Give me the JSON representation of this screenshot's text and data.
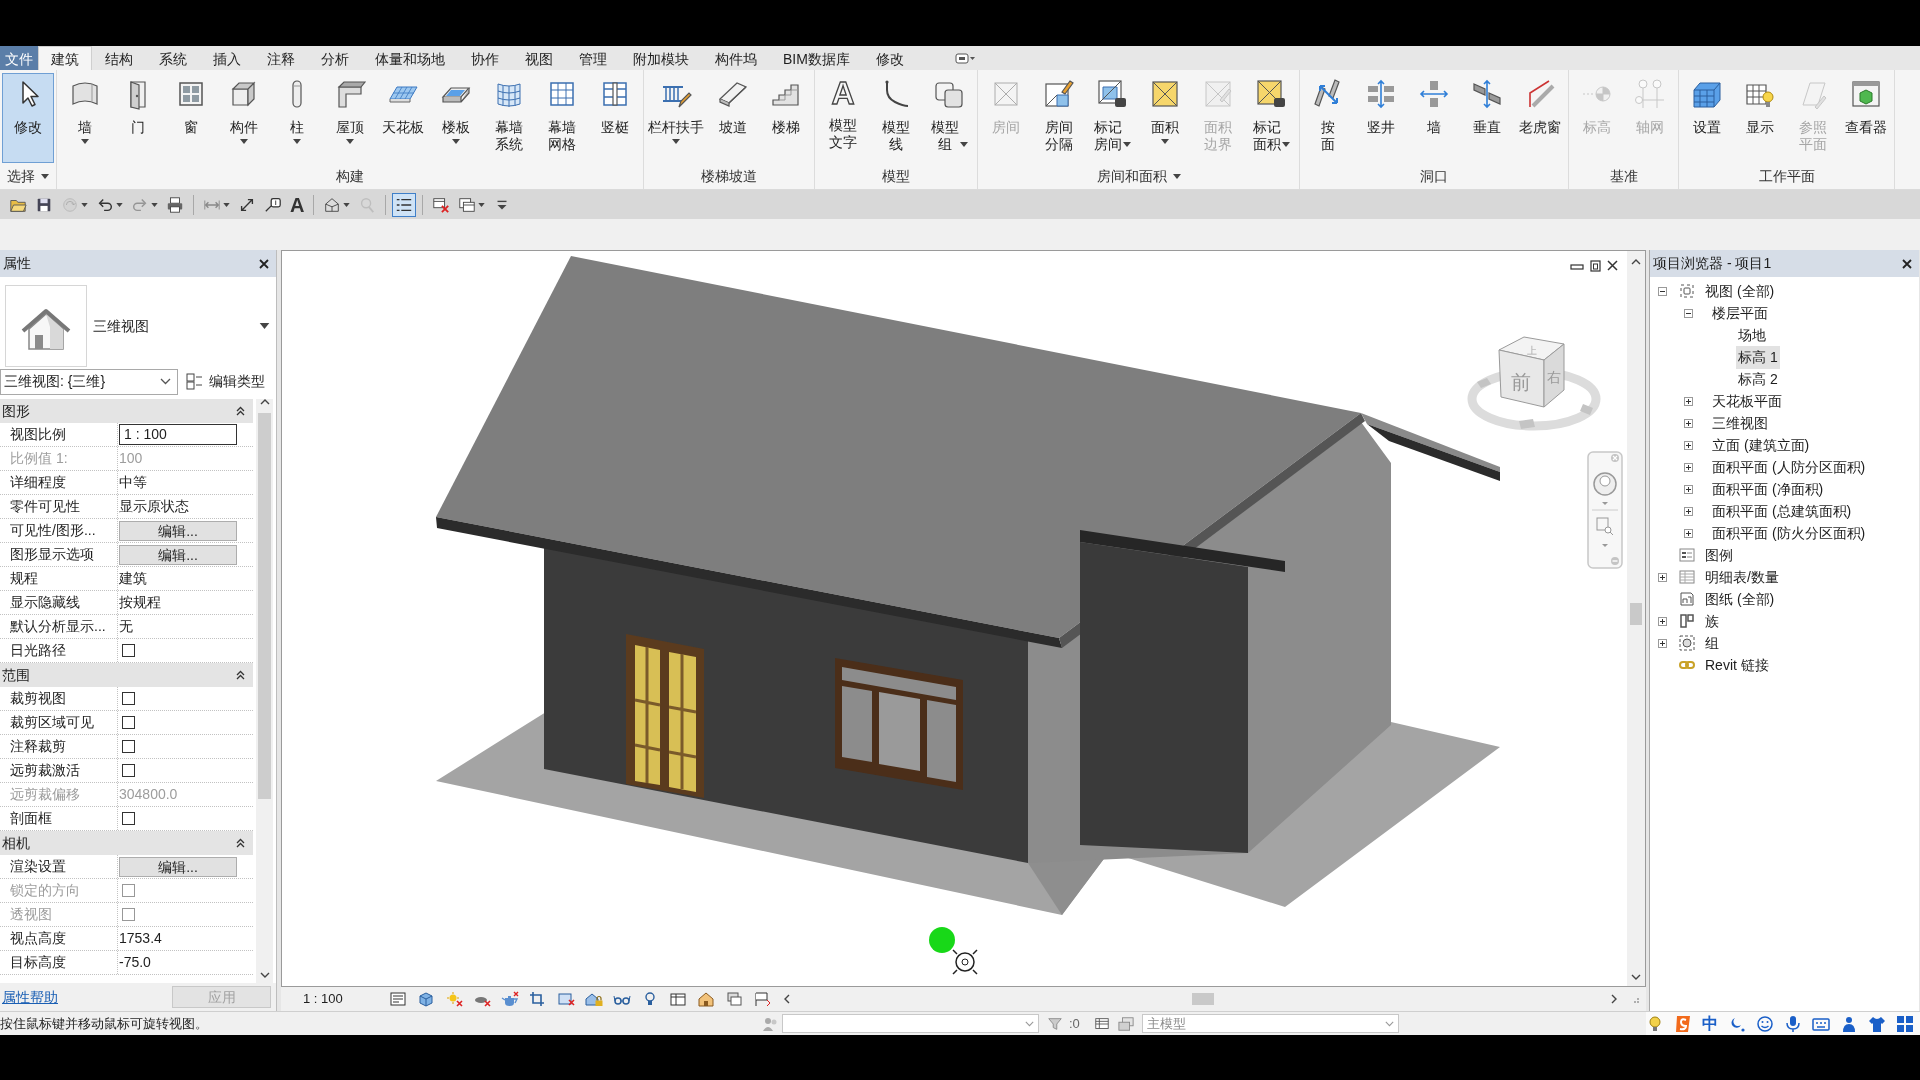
{
  "ribbon": {
    "tabs": [
      {
        "label": "文件",
        "kind": "file",
        "selected": false
      },
      {
        "label": "建筑",
        "kind": "tab",
        "selected": true
      },
      {
        "label": "结构",
        "kind": "tab",
        "selected": false
      },
      {
        "label": "系统",
        "kind": "tab",
        "selected": false
      },
      {
        "label": "插入",
        "kind": "tab",
        "selected": false
      },
      {
        "label": "注释",
        "kind": "tab",
        "selected": false
      },
      {
        "label": "分析",
        "kind": "tab",
        "selected": false
      },
      {
        "label": "体量和场地",
        "kind": "tab",
        "selected": false
      },
      {
        "label": "协作",
        "kind": "tab",
        "selected": false
      },
      {
        "label": "视图",
        "kind": "tab",
        "selected": false
      },
      {
        "label": "管理",
        "kind": "tab",
        "selected": false
      },
      {
        "label": "附加模块",
        "kind": "tab",
        "selected": false
      },
      {
        "label": "构件坞",
        "kind": "tab",
        "selected": false
      },
      {
        "label": "BIM数据库",
        "kind": "tab",
        "selected": false
      },
      {
        "label": "修改",
        "kind": "tab",
        "selected": false
      }
    ],
    "panels": [
      {
        "title": "选择",
        "menu": true,
        "buttons": [
          {
            "label": "修改",
            "kind": "modify",
            "active": true,
            "dropdown": false,
            "disabled": false
          }
        ]
      },
      {
        "title": "构建",
        "menu": false,
        "buttons": [
          {
            "label": "墙",
            "kind": "wall",
            "active": false,
            "dropdown": true,
            "disabled": false
          },
          {
            "label": "门",
            "kind": "door",
            "active": false,
            "dropdown": false,
            "disabled": false
          },
          {
            "label": "窗",
            "kind": "window",
            "active": false,
            "dropdown": false,
            "disabled": false
          },
          {
            "label": "构件",
            "kind": "component",
            "active": false,
            "dropdown": true,
            "disabled": false
          },
          {
            "label": "柱",
            "kind": "column",
            "active": false,
            "dropdown": true,
            "disabled": false
          },
          {
            "label": "屋顶",
            "kind": "roof",
            "active": false,
            "dropdown": true,
            "disabled": false
          },
          {
            "label": "天花板",
            "kind": "ceiling",
            "active": false,
            "dropdown": false,
            "disabled": false
          },
          {
            "label": "楼板",
            "kind": "floor",
            "active": false,
            "dropdown": true,
            "disabled": false
          },
          {
            "label": "幕墙系统",
            "kind": "curtain_system",
            "active": false,
            "dropdown": false,
            "disabled": false
          },
          {
            "label": "幕墙网格",
            "kind": "curtain_grid",
            "active": false,
            "dropdown": false,
            "disabled": false
          },
          {
            "label": "竖梃",
            "kind": "mullion",
            "active": false,
            "dropdown": false,
            "disabled": false
          }
        ]
      },
      {
        "title": "楼梯坡道",
        "menu": false,
        "buttons": [
          {
            "label": "栏杆扶手",
            "kind": "railing",
            "active": false,
            "dropdown": true,
            "disabled": false
          },
          {
            "label": "坡道",
            "kind": "ramp",
            "active": false,
            "dropdown": false,
            "disabled": false
          },
          {
            "label": "楼梯",
            "kind": "stair",
            "active": false,
            "dropdown": false,
            "disabled": false
          }
        ]
      },
      {
        "title": "模型",
        "menu": false,
        "buttons": [
          {
            "label": "模型文字",
            "kind": "model_text",
            "glyph": "A",
            "active": false,
            "dropdown": false,
            "disabled": false
          },
          {
            "label": "模型线",
            "kind": "model_line",
            "active": false,
            "dropdown": false,
            "disabled": false
          },
          {
            "label": "模型组",
            "kind": "model_group",
            "active": false,
            "dropdown": true,
            "disabled": false
          }
        ]
      },
      {
        "title": "房间和面积",
        "menu": true,
        "buttons": [
          {
            "label": "房间",
            "kind": "room",
            "active": false,
            "dropdown": false,
            "disabled": true
          },
          {
            "label": "房间分隔",
            "kind": "room_separator",
            "active": false,
            "dropdown": false,
            "disabled": false
          },
          {
            "label": "标记房间",
            "kind": "tag_room",
            "active": false,
            "dropdown": true,
            "disabled": false
          },
          {
            "label": "面积",
            "kind": "area",
            "active": false,
            "dropdown": true,
            "disabled": false
          },
          {
            "label": "面积边界",
            "kind": "area_boundary",
            "active": false,
            "dropdown": false,
            "disabled": true
          },
          {
            "label": "标记面积",
            "kind": "tag_area",
            "active": false,
            "dropdown": true,
            "disabled": false
          }
        ]
      },
      {
        "title": "洞口",
        "menu": false,
        "buttons": [
          {
            "label": "按面",
            "kind": "by_face",
            "active": false,
            "dropdown": false,
            "disabled": false
          },
          {
            "label": "竖井",
            "kind": "shaft",
            "active": false,
            "dropdown": false,
            "disabled": false
          },
          {
            "label": "墙",
            "kind": "wall_opening",
            "active": false,
            "dropdown": false,
            "disabled": false
          },
          {
            "label": "垂直",
            "kind": "vertical",
            "active": false,
            "dropdown": false,
            "disabled": false
          },
          {
            "label": "老虎窗",
            "kind": "dormer",
            "active": false,
            "dropdown": false,
            "disabled": false
          }
        ]
      },
      {
        "title": "基准",
        "menu": false,
        "buttons": [
          {
            "label": "标高",
            "kind": "level",
            "active": false,
            "dropdown": false,
            "disabled": true
          },
          {
            "label": "轴网",
            "kind": "grid",
            "active": false,
            "dropdown": false,
            "disabled": true
          }
        ]
      },
      {
        "title": "工作平面",
        "menu": false,
        "buttons": [
          {
            "label": "设置",
            "kind": "set_plane",
            "active": false,
            "dropdown": false,
            "disabled": false
          },
          {
            "label": "显示",
            "kind": "show_plane",
            "active": false,
            "dropdown": false,
            "disabled": false
          },
          {
            "label": "参照平面",
            "kind": "ref_plane",
            "active": false,
            "dropdown": false,
            "disabled": true
          },
          {
            "label": "查看器",
            "kind": "viewer",
            "active": false,
            "dropdown": false,
            "disabled": false
          }
        ]
      }
    ]
  },
  "quick_access_toolbar": [
    {
      "kind": "open",
      "disabled": false,
      "dropdown": false,
      "on": false
    },
    {
      "kind": "save",
      "disabled": false,
      "dropdown": false,
      "on": false
    },
    {
      "kind": "sync",
      "disabled": true,
      "dropdown": true,
      "on": false
    },
    {
      "kind": "undo",
      "disabled": false,
      "dropdown": true,
      "on": false
    },
    {
      "kind": "redo",
      "disabled": true,
      "dropdown": true,
      "on": false
    },
    {
      "kind": "print",
      "disabled": false,
      "dropdown": false,
      "on": false
    },
    {
      "kind": "separator"
    },
    {
      "kind": "measure",
      "disabled": false,
      "dropdown": true,
      "on": false
    },
    {
      "kind": "dimension",
      "disabled": false,
      "dropdown": false,
      "on": false
    },
    {
      "kind": "tag",
      "disabled": false,
      "dropdown": false,
      "on": false
    },
    {
      "kind": "text",
      "glyph": "A",
      "disabled": false,
      "dropdown": false,
      "on": false
    },
    {
      "kind": "separator"
    },
    {
      "kind": "house",
      "disabled": false,
      "dropdown": true,
      "on": false
    },
    {
      "kind": "pin",
      "disabled": true,
      "dropdown": false,
      "on": false
    },
    {
      "kind": "separator"
    },
    {
      "kind": "thin_lines",
      "disabled": false,
      "dropdown": false,
      "on": true
    },
    {
      "kind": "separator"
    },
    {
      "kind": "close_windows",
      "disabled": false,
      "dropdown": false,
      "on": false
    },
    {
      "kind": "switch_windows",
      "disabled": false,
      "dropdown": true,
      "on": false
    },
    {
      "kind": "customize",
      "disabled": false,
      "dropdown": false,
      "on": false
    }
  ],
  "properties": {
    "title": "属性",
    "type_name": "三维视图",
    "view_selector": "三维视图: {三维}",
    "edit_type": "编辑类型",
    "groups": [
      {
        "name": "图形",
        "expanded": true,
        "rows": [
          {
            "name": "视图比例",
            "kind": "field",
            "value": "1 : 100",
            "disabled": false
          },
          {
            "name": "比例值 1:",
            "kind": "text",
            "value": "100",
            "disabled": true
          },
          {
            "name": "详细程度",
            "kind": "text",
            "value": "中等",
            "disabled": false
          },
          {
            "name": "零件可见性",
            "kind": "text",
            "value": "显示原状态",
            "disabled": false
          },
          {
            "name": "可见性/图形...",
            "kind": "button",
            "value": "编辑...",
            "disabled": false
          },
          {
            "name": "图形显示选项",
            "kind": "button",
            "value": "编辑...",
            "disabled": false
          },
          {
            "name": "规程",
            "kind": "text",
            "value": "建筑",
            "disabled": false
          },
          {
            "name": "显示隐藏线",
            "kind": "text",
            "value": "按规程",
            "disabled": false
          },
          {
            "name": "默认分析显示...",
            "kind": "text",
            "value": "无",
            "disabled": false
          },
          {
            "name": "日光路径",
            "kind": "checkbox",
            "checked": false,
            "disabled": false
          }
        ]
      },
      {
        "name": "范围",
        "expanded": true,
        "rows": [
          {
            "name": "裁剪视图",
            "kind": "checkbox",
            "checked": false,
            "disabled": false
          },
          {
            "name": "裁剪区域可见",
            "kind": "checkbox",
            "checked": false,
            "disabled": false
          },
          {
            "name": "注释裁剪",
            "kind": "checkbox",
            "checked": false,
            "disabled": false
          },
          {
            "name": "远剪裁激活",
            "kind": "checkbox",
            "checked": false,
            "disabled": false
          },
          {
            "name": "远剪裁偏移",
            "kind": "text",
            "value": "304800.0",
            "disabled": true
          },
          {
            "name": "剖面框",
            "kind": "checkbox",
            "checked": false,
            "disabled": false
          }
        ]
      },
      {
        "name": "相机",
        "expanded": true,
        "rows": [
          {
            "name": "渲染设置",
            "kind": "button",
            "value": "编辑...",
            "disabled": false
          },
          {
            "name": "锁定的方向",
            "kind": "checkbox",
            "checked": false,
            "disabled": true
          },
          {
            "name": "透视图",
            "kind": "checkbox",
            "checked": false,
            "disabled": true
          },
          {
            "name": "视点高度",
            "kind": "text",
            "value": "1753.4",
            "disabled": false
          },
          {
            "name": "目标高度",
            "kind": "text",
            "value": "-75.0",
            "disabled": false
          }
        ]
      }
    ],
    "help": "属性帮助",
    "apply": {
      "label": "应用",
      "disabled": true
    }
  },
  "viewport": {
    "scale": "1 : 100",
    "view_cube": {
      "top": "上",
      "front": "前",
      "right": "右"
    }
  },
  "project_browser": {
    "title": "项目浏览器 - 项目1",
    "tree": [
      {
        "label": "视图 (全部)",
        "kind": "views",
        "expanded": true,
        "selected": false,
        "children": [
          {
            "label": "楼层平面",
            "expanded": true,
            "selected": false,
            "children": [
              {
                "label": "场地",
                "selected": false
              },
              {
                "label": "标高 1",
                "selected": true
              },
              {
                "label": "标高 2",
                "selected": false
              }
            ]
          },
          {
            "label": "天花板平面",
            "expanded": false,
            "selected": false
          },
          {
            "label": "三维视图",
            "expanded": false,
            "selected": false
          },
          {
            "label": "立面 (建筑立面)",
            "expanded": false,
            "selected": false
          },
          {
            "label": "面积平面 (人防分区面积)",
            "expanded": false,
            "selected": false
          },
          {
            "label": "面积平面 (净面积)",
            "expanded": false,
            "selected": false
          },
          {
            "label": "面积平面 (总建筑面积)",
            "expanded": false,
            "selected": false
          },
          {
            "label": "面积平面 (防火分区面积)",
            "expanded": false,
            "selected": false
          }
        ]
      },
      {
        "label": "图例",
        "kind": "legend",
        "selected": false
      },
      {
        "label": "明细表/数量",
        "kind": "schedule",
        "expanded": false,
        "selected": false
      },
      {
        "label": "图纸 (全部)",
        "kind": "sheet",
        "selected": false
      },
      {
        "label": "族",
        "kind": "family",
        "expanded": false,
        "selected": false
      },
      {
        "label": "组",
        "kind": "group",
        "expanded": false,
        "selected": false
      },
      {
        "label": "Revit 链接",
        "kind": "link",
        "selected": false
      }
    ]
  },
  "status_bar": {
    "message": "按住鼠标键并移动鼠标可旋转视图。",
    "selection_count": ":0",
    "model": "主模型",
    "ime": "中"
  }
}
